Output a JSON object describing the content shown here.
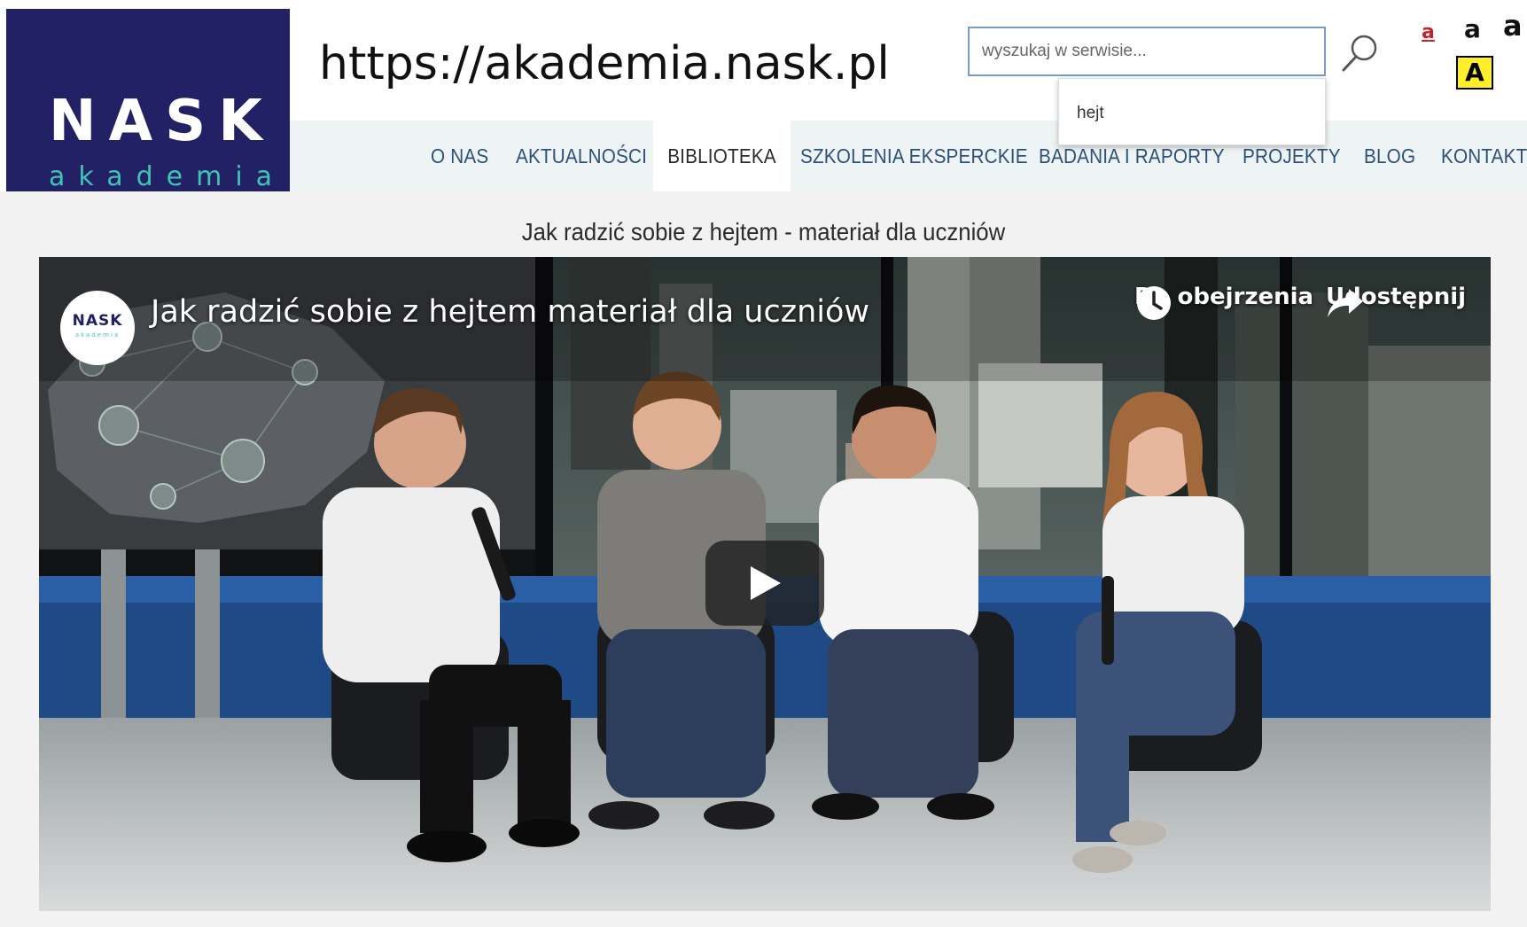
{
  "logo": {
    "name": "NASK",
    "sub": "akademia"
  },
  "url": "https://akademia.nask.pl",
  "search": {
    "placeholder": "wyszukaj w serwisie...",
    "suggestion": "hejt"
  },
  "accessibility": {
    "small": "a",
    "medium": "a",
    "large": "a",
    "contrast": "A"
  },
  "nav": {
    "items": [
      {
        "label": "O NAS"
      },
      {
        "label": "AKTUALNOŚCI"
      },
      {
        "label": "BIBLIOTEKA",
        "active": true
      },
      {
        "label": "SZKOLENIA EKSPERCKIE"
      },
      {
        "label": "BADANIA I RAPORTY"
      },
      {
        "label": "PROJEKTY"
      },
      {
        "label": "BLOG"
      },
      {
        "label": "KONTAKT"
      }
    ]
  },
  "page": {
    "title": "Jak radzić sobie z hejtem - materiał dla uczniów"
  },
  "video": {
    "channel_logo": "NASK",
    "channel_logo_sub": "akademia",
    "title": "Jak radzić sobie z hejtem materiał dla uczniów",
    "watch_later": "Do obejrzenia",
    "share": "Udostępnij",
    "icons": {
      "watch_later": "clock-icon",
      "share": "share-arrow-icon",
      "play": "play-icon"
    }
  },
  "colors": {
    "brand_navy": "#232165",
    "brand_teal": "#3fc4b4",
    "nav_text": "#2d4f7c",
    "contrast_yellow": "#ffef2a",
    "small_a_red": "#c0262c"
  }
}
